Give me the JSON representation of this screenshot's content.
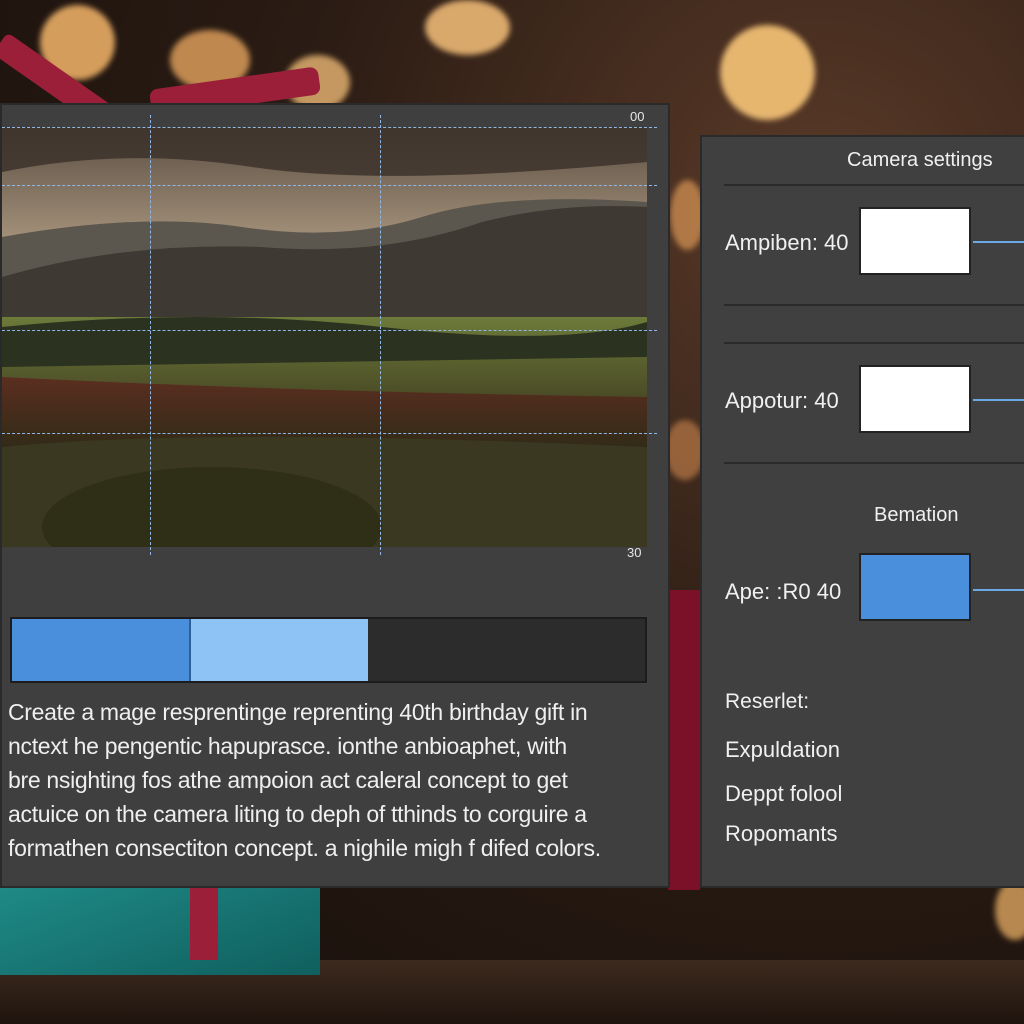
{
  "preview": {
    "corner_top_right": "00",
    "corner_bottom_right": "30",
    "progress": {
      "segment1_fraction": 0.28,
      "segment2_fraction": 0.28
    },
    "prompt_lines": [
      "Create a mage resprentinge reprenting 40th birthday gift in",
      "nctext he pengentic hapuprasce. ionthe anbioaphet, with",
      "bre nsighting fos athe ampoion act caleral concept to get",
      " actuice on the camera liting to deph of tthinds to corguire a",
      "formathen consectiton concept. a nighile migh f difed colors."
    ]
  },
  "settings": {
    "title": "Camera settings",
    "fields": [
      {
        "label": "Ampiben:  40",
        "box_color": "#ffffff"
      },
      {
        "label": "Appotur:  40",
        "box_color": "#ffffff"
      },
      {
        "label": "Ape:  :R0  40",
        "box_color": "#4a8fdc"
      }
    ],
    "section_header": "Bemation",
    "list": [
      "Reserlet:",
      "Expuldation",
      "Deppt folool",
      "Ropomants"
    ]
  }
}
